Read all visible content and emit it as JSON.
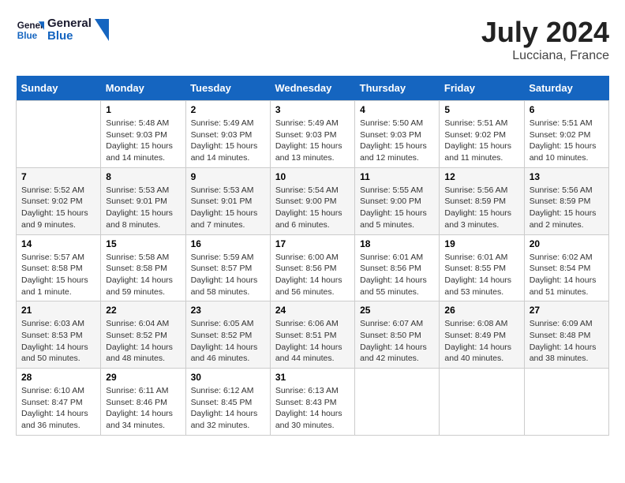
{
  "header": {
    "logo_general": "General",
    "logo_blue": "Blue",
    "month": "July 2024",
    "location": "Lucciana, France"
  },
  "weekdays": [
    "Sunday",
    "Monday",
    "Tuesday",
    "Wednesday",
    "Thursday",
    "Friday",
    "Saturday"
  ],
  "weeks": [
    [
      {
        "day": "",
        "info": ""
      },
      {
        "day": "1",
        "info": "Sunrise: 5:48 AM\nSunset: 9:03 PM\nDaylight: 15 hours\nand 14 minutes."
      },
      {
        "day": "2",
        "info": "Sunrise: 5:49 AM\nSunset: 9:03 PM\nDaylight: 15 hours\nand 14 minutes."
      },
      {
        "day": "3",
        "info": "Sunrise: 5:49 AM\nSunset: 9:03 PM\nDaylight: 15 hours\nand 13 minutes."
      },
      {
        "day": "4",
        "info": "Sunrise: 5:50 AM\nSunset: 9:03 PM\nDaylight: 15 hours\nand 12 minutes."
      },
      {
        "day": "5",
        "info": "Sunrise: 5:51 AM\nSunset: 9:02 PM\nDaylight: 15 hours\nand 11 minutes."
      },
      {
        "day": "6",
        "info": "Sunrise: 5:51 AM\nSunset: 9:02 PM\nDaylight: 15 hours\nand 10 minutes."
      }
    ],
    [
      {
        "day": "7",
        "info": "Sunrise: 5:52 AM\nSunset: 9:02 PM\nDaylight: 15 hours\nand 9 minutes."
      },
      {
        "day": "8",
        "info": "Sunrise: 5:53 AM\nSunset: 9:01 PM\nDaylight: 15 hours\nand 8 minutes."
      },
      {
        "day": "9",
        "info": "Sunrise: 5:53 AM\nSunset: 9:01 PM\nDaylight: 15 hours\nand 7 minutes."
      },
      {
        "day": "10",
        "info": "Sunrise: 5:54 AM\nSunset: 9:00 PM\nDaylight: 15 hours\nand 6 minutes."
      },
      {
        "day": "11",
        "info": "Sunrise: 5:55 AM\nSunset: 9:00 PM\nDaylight: 15 hours\nand 5 minutes."
      },
      {
        "day": "12",
        "info": "Sunrise: 5:56 AM\nSunset: 8:59 PM\nDaylight: 15 hours\nand 3 minutes."
      },
      {
        "day": "13",
        "info": "Sunrise: 5:56 AM\nSunset: 8:59 PM\nDaylight: 15 hours\nand 2 minutes."
      }
    ],
    [
      {
        "day": "14",
        "info": "Sunrise: 5:57 AM\nSunset: 8:58 PM\nDaylight: 15 hours\nand 1 minute."
      },
      {
        "day": "15",
        "info": "Sunrise: 5:58 AM\nSunset: 8:58 PM\nDaylight: 14 hours\nand 59 minutes."
      },
      {
        "day": "16",
        "info": "Sunrise: 5:59 AM\nSunset: 8:57 PM\nDaylight: 14 hours\nand 58 minutes."
      },
      {
        "day": "17",
        "info": "Sunrise: 6:00 AM\nSunset: 8:56 PM\nDaylight: 14 hours\nand 56 minutes."
      },
      {
        "day": "18",
        "info": "Sunrise: 6:01 AM\nSunset: 8:56 PM\nDaylight: 14 hours\nand 55 minutes."
      },
      {
        "day": "19",
        "info": "Sunrise: 6:01 AM\nSunset: 8:55 PM\nDaylight: 14 hours\nand 53 minutes."
      },
      {
        "day": "20",
        "info": "Sunrise: 6:02 AM\nSunset: 8:54 PM\nDaylight: 14 hours\nand 51 minutes."
      }
    ],
    [
      {
        "day": "21",
        "info": "Sunrise: 6:03 AM\nSunset: 8:53 PM\nDaylight: 14 hours\nand 50 minutes."
      },
      {
        "day": "22",
        "info": "Sunrise: 6:04 AM\nSunset: 8:52 PM\nDaylight: 14 hours\nand 48 minutes."
      },
      {
        "day": "23",
        "info": "Sunrise: 6:05 AM\nSunset: 8:52 PM\nDaylight: 14 hours\nand 46 minutes."
      },
      {
        "day": "24",
        "info": "Sunrise: 6:06 AM\nSunset: 8:51 PM\nDaylight: 14 hours\nand 44 minutes."
      },
      {
        "day": "25",
        "info": "Sunrise: 6:07 AM\nSunset: 8:50 PM\nDaylight: 14 hours\nand 42 minutes."
      },
      {
        "day": "26",
        "info": "Sunrise: 6:08 AM\nSunset: 8:49 PM\nDaylight: 14 hours\nand 40 minutes."
      },
      {
        "day": "27",
        "info": "Sunrise: 6:09 AM\nSunset: 8:48 PM\nDaylight: 14 hours\nand 38 minutes."
      }
    ],
    [
      {
        "day": "28",
        "info": "Sunrise: 6:10 AM\nSunset: 8:47 PM\nDaylight: 14 hours\nand 36 minutes."
      },
      {
        "day": "29",
        "info": "Sunrise: 6:11 AM\nSunset: 8:46 PM\nDaylight: 14 hours\nand 34 minutes."
      },
      {
        "day": "30",
        "info": "Sunrise: 6:12 AM\nSunset: 8:45 PM\nDaylight: 14 hours\nand 32 minutes."
      },
      {
        "day": "31",
        "info": "Sunrise: 6:13 AM\nSunset: 8:43 PM\nDaylight: 14 hours\nand 30 minutes."
      },
      {
        "day": "",
        "info": ""
      },
      {
        "day": "",
        "info": ""
      },
      {
        "day": "",
        "info": ""
      }
    ]
  ]
}
